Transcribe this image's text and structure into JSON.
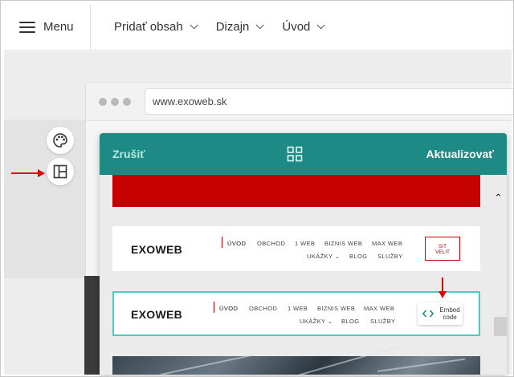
{
  "toolbar": {
    "menu_label": "Menu",
    "nav": [
      {
        "label": "Pridať obsah"
      },
      {
        "label": "Dizajn"
      },
      {
        "label": "Úvod"
      }
    ]
  },
  "browser": {
    "url": "www.exoweb.sk"
  },
  "side_tools": {
    "design_icon": "palette-icon",
    "layout_icon": "layout-icon"
  },
  "modal": {
    "cancel_label": "Zrušiť",
    "update_label": "Aktualizovať",
    "center_icon": "grid-layout-icon"
  },
  "header_variant_1": {
    "logo": "EXOWEB",
    "menu_row1": [
      "ÚVOD",
      "OBCHOD",
      "1 WEB",
      "BIZNIS WEB",
      "MAX WEB"
    ],
    "menu_row2": [
      "UKÁŽKY ⌄",
      "BLOG",
      "SLUŽBY"
    ],
    "cta_line1": "SIT",
    "cta_line2": "VELIT"
  },
  "header_variant_2": {
    "logo": "EXOWEB",
    "menu_row1": [
      "ÚVOD",
      "OBCHOD",
      "1 WEB",
      "BIZNIS WEB",
      "MAX WEB"
    ],
    "menu_row2": [
      "UKÁŽKY ⌄",
      "BLOG",
      "SLUŽBY"
    ],
    "embed_line1": "Embed",
    "embed_line2": "code"
  },
  "colors": {
    "teal": "#1d8a85",
    "red": "#c70000",
    "selection": "#53c8c0",
    "annotation_arrow": "#e00000"
  }
}
